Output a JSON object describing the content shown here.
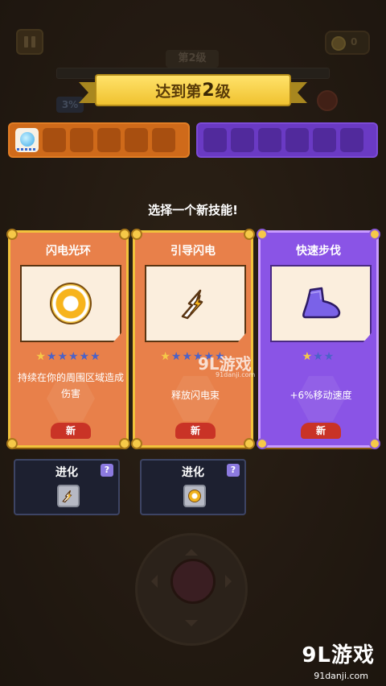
{
  "hud": {
    "level_small": "第2级",
    "xp_percent": "3%"
  },
  "banner": {
    "prefix": "达到第",
    "level": "2",
    "suffix": "级"
  },
  "choose_title": "选择一个新技能!",
  "cards": [
    {
      "name": "闪电光环",
      "icon": "lightning-ring-icon",
      "stars_gold": 1,
      "stars_blue": 5,
      "description": "持续在你的周围区域造成伤害",
      "badge": "新",
      "theme": "orange"
    },
    {
      "name": "引导闪电",
      "icon": "lightning-bolt-icon",
      "stars_gold": 1,
      "stars_blue": 5,
      "description": "释放闪电束",
      "badge": "新",
      "theme": "orange"
    },
    {
      "name": "快速步伐",
      "icon": "boot-icon",
      "stars_gold": 1,
      "stars_blue": 2,
      "description": "+6%移动速度",
      "badge": "新",
      "theme": "purple"
    }
  ],
  "evolve": [
    {
      "label": "进化",
      "help": "?",
      "icon": "lightning-bolt-icon"
    },
    {
      "label": "进化",
      "help": "?",
      "icon": "lightning-ring-icon"
    }
  ],
  "watermark": {
    "logo": "9L游戏",
    "url": "91danji.com",
    "mid": "9L游戏",
    "mid_url": "91danji.com"
  },
  "colors": {
    "orange_card": "#e8804a",
    "purple_card": "#8a54e6",
    "banner_gold": "#f0c230",
    "badge_red": "#c93326"
  }
}
